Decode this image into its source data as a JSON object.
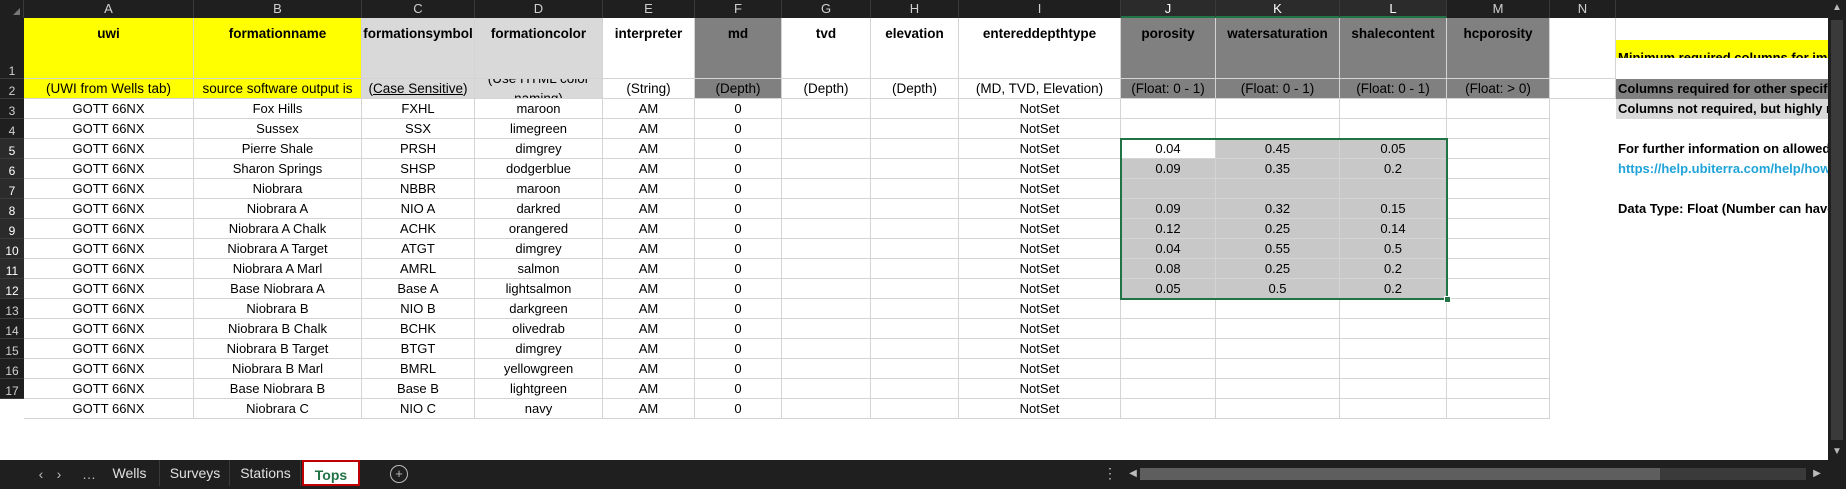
{
  "columns": [
    "A",
    "B",
    "C",
    "D",
    "E",
    "F",
    "G",
    "H",
    "I",
    "J",
    "K",
    "L",
    "M",
    "N"
  ],
  "rows": [
    "1",
    "2",
    "3",
    "4",
    "5",
    "6",
    "7",
    "8",
    "9",
    "10",
    "11",
    "12",
    "13",
    "14",
    "15",
    "16",
    "17"
  ],
  "header": {
    "uwi": "uwi",
    "formationname": "formationname",
    "formationsymbol": "formationsymbol",
    "formationcolor": "formationcolor",
    "interpreter": "interpreter",
    "md": "md",
    "tvd": "tvd",
    "elevation": "elevation",
    "entereddepthtype": "entereddepthtype",
    "porosity": "porosity",
    "watersaturation": "watersaturation",
    "shalecontent": "shalecontent",
    "hcporosity": "hcporosity"
  },
  "subheader": {
    "uwi": "(UWI from Wells tab)",
    "formationname_u": "Case Sensitive",
    "formationname_rest": ": Matching source software output is recommended)",
    "formationname_open": "(",
    "formationsymbol_open": "(",
    "formationsymbol_u": "Case Sensitive",
    "formationsymbol_close": ")",
    "formationcolor": "(Use HTML color naming)",
    "interpreter": "(String)",
    "md": "(Depth)",
    "tvd": "(Depth)",
    "elevation": "(Depth)",
    "entereddepthtype": "(MD, TVD, Elevation)",
    "porosity": "(Float: 0 - 1)",
    "watersaturation": "(Float: 0 - 1)",
    "shalecontent": "(Float: 0 - 1)",
    "hcporosity": "(Float: > 0)"
  },
  "data_rows": [
    {
      "uwi": "GOTT 66NX",
      "name": "Fox Hills",
      "symbol": "FXHL",
      "color": "maroon",
      "interp": "AM",
      "md": "0",
      "type": "NotSet",
      "por": "",
      "ws": "",
      "sh": ""
    },
    {
      "uwi": "GOTT 66NX",
      "name": "Sussex",
      "symbol": "SSX",
      "color": "limegreen",
      "interp": "AM",
      "md": "0",
      "type": "NotSet",
      "por": "",
      "ws": "",
      "sh": ""
    },
    {
      "uwi": "GOTT 66NX",
      "name": "Pierre Shale",
      "symbol": "PRSH",
      "color": "dimgrey",
      "interp": "AM",
      "md": "0",
      "type": "NotSet",
      "por": "0.04",
      "ws": "0.45",
      "sh": "0.05"
    },
    {
      "uwi": "GOTT 66NX",
      "name": "Sharon Springs",
      "symbol": "SHSP",
      "color": "dodgerblue",
      "interp": "AM",
      "md": "0",
      "type": "NotSet",
      "por": "0.09",
      "ws": "0.35",
      "sh": "0.2"
    },
    {
      "uwi": "GOTT 66NX",
      "name": "Niobrara",
      "symbol": "NBBR",
      "color": "maroon",
      "interp": "AM",
      "md": "0",
      "type": "NotSet",
      "por": "",
      "ws": "",
      "sh": ""
    },
    {
      "uwi": "GOTT 66NX",
      "name": "Niobrara A",
      "symbol": "NIO A",
      "color": "darkred",
      "interp": "AM",
      "md": "0",
      "type": "NotSet",
      "por": "0.09",
      "ws": "0.32",
      "sh": "0.15"
    },
    {
      "uwi": "GOTT 66NX",
      "name": "Niobrara A Chalk",
      "symbol": "ACHK",
      "color": "orangered",
      "interp": "AM",
      "md": "0",
      "type": "NotSet",
      "por": "0.12",
      "ws": "0.25",
      "sh": "0.14"
    },
    {
      "uwi": "GOTT 66NX",
      "name": "Niobrara A Target",
      "symbol": "ATGT",
      "color": "dimgrey",
      "interp": "AM",
      "md": "0",
      "type": "NotSet",
      "por": "0.04",
      "ws": "0.55",
      "sh": "0.5"
    },
    {
      "uwi": "GOTT 66NX",
      "name": "Niobrara A Marl",
      "symbol": "AMRL",
      "color": "salmon",
      "interp": "AM",
      "md": "0",
      "type": "NotSet",
      "por": "0.08",
      "ws": "0.25",
      "sh": "0.2"
    },
    {
      "uwi": "GOTT 66NX",
      "name": "Base Niobrara A",
      "symbol": "Base A",
      "color": "lightsalmon",
      "interp": "AM",
      "md": "0",
      "type": "NotSet",
      "por": "0.05",
      "ws": "0.5",
      "sh": "0.2"
    },
    {
      "uwi": "GOTT 66NX",
      "name": "Niobrara B",
      "symbol": "NIO B",
      "color": "darkgreen",
      "interp": "AM",
      "md": "0",
      "type": "NotSet",
      "por": "",
      "ws": "",
      "sh": ""
    },
    {
      "uwi": "GOTT 66NX",
      "name": "Niobrara B Chalk",
      "symbol": "BCHK",
      "color": "olivedrab",
      "interp": "AM",
      "md": "0",
      "type": "NotSet",
      "por": "",
      "ws": "",
      "sh": ""
    },
    {
      "uwi": "GOTT 66NX",
      "name": "Niobrara B Target",
      "symbol": "BTGT",
      "color": "dimgrey",
      "interp": "AM",
      "md": "0",
      "type": "NotSet",
      "por": "",
      "ws": "",
      "sh": ""
    },
    {
      "uwi": "GOTT 66NX",
      "name": "Niobrara B Marl",
      "symbol": "BMRL",
      "color": "yellowgreen",
      "interp": "AM",
      "md": "0",
      "type": "NotSet",
      "por": "",
      "ws": "",
      "sh": ""
    },
    {
      "uwi": "GOTT 66NX",
      "name": "Base Niobrara B",
      "symbol": "Base B",
      "color": "lightgreen",
      "interp": "AM",
      "md": "0",
      "type": "NotSet",
      "por": "",
      "ws": "",
      "sh": ""
    },
    {
      "uwi": "GOTT 66NX",
      "name": "Niobrara C",
      "symbol": "NIO C",
      "color": "navy",
      "interp": "AM",
      "md": "0",
      "type": "NotSet",
      "por": "",
      "ws": "",
      "sh": ""
    }
  ],
  "notes": {
    "minimum": "Minimum required columns for import",
    "required_other": "Columns required for other specific uses",
    "not_required": "Columns not required, but highly recommended",
    "further_info": "For further information on allowed values",
    "link": "https://help.ubiterra.com/help/how-to",
    "data_type": "Data Type: Float (Number can have decimals)"
  },
  "tabs": [
    "Wells",
    "Surveys",
    "Stations",
    "Tops"
  ],
  "active_tab": "Tops",
  "colors": {
    "yellow": "#ffff00",
    "light_gray": "#d9d9d9",
    "dark_gray": "#808080",
    "selection": "#217346",
    "link": "#1fa3d9"
  }
}
